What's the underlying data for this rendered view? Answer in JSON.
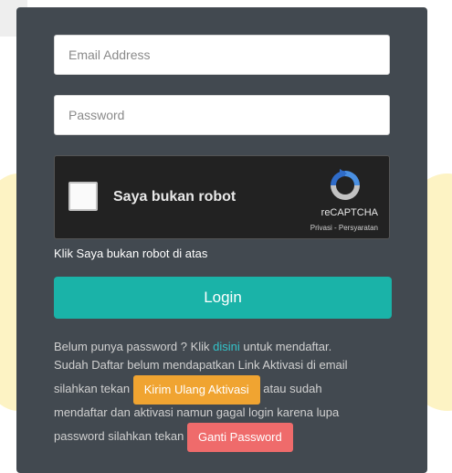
{
  "form": {
    "email_placeholder": "Email Address",
    "password_placeholder": "Password"
  },
  "captcha": {
    "checkbox_label": "Saya bukan robot",
    "brand": "reCAPTCHA",
    "links": "Privasi - Persyaratan",
    "icon": "recaptcha-logo-icon"
  },
  "hint": "Klik Saya bukan robot di atas",
  "login_label": "Login",
  "info": {
    "line1_prefix": "Belum punya password ? Klik ",
    "line1_link": "disini",
    "line1_suffix": " untuk mendaftar.",
    "line2": "Sudah Daftar belum mendapatkan Link Aktivasi di email",
    "line3_prefix": "silahkan tekan ",
    "resend_label": "Kirim Ulang Aktivasi",
    "line3_suffix": " atau sudah",
    "line4": "mendaftar dan aktivasi namun gagal login karena lupa",
    "line5_prefix": "password silahkan tekan ",
    "reset_label": "Ganti Password"
  },
  "colors": {
    "panel": "#424950",
    "login": "#1ab3a8",
    "resend": "#f0a431",
    "reset": "#ef6b6b",
    "link": "#33c3c9"
  }
}
